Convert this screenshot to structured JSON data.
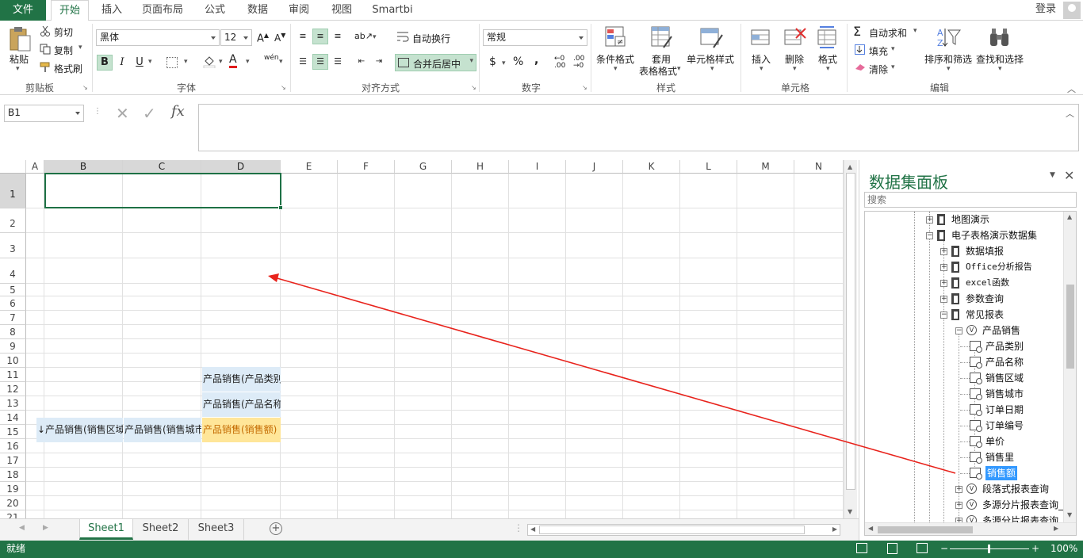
{
  "ribbon_tabs": {
    "file": "文件",
    "items": [
      "开始",
      "插入",
      "页面布局",
      "公式",
      "数据",
      "审阅",
      "视图",
      "Smartbi"
    ],
    "active": "开始",
    "login": "登录"
  },
  "clipboard": {
    "paste": "粘贴",
    "cut": "剪切",
    "copy": "复制",
    "format_painter": "格式刷",
    "group": "剪贴板"
  },
  "font": {
    "name": "黑体",
    "size": "12",
    "bold": "B",
    "italic": "I",
    "underline": "U",
    "font_color_letter": "A",
    "phonetic": "wén",
    "group": "字体"
  },
  "alignment": {
    "wrap": "自动换行",
    "merge": "合并后居中",
    "group": "对齐方式"
  },
  "number": {
    "format": "常规",
    "currency": "$",
    "percent": "%",
    "comma": ",",
    "group": "数字"
  },
  "styles": {
    "conditional": "条件格式",
    "table_l1": "套用",
    "table_l2": "表格格式",
    "cell_style": "单元格样式",
    "group": "样式"
  },
  "cells": {
    "insert": "插入",
    "delete": "删除",
    "format": "格式",
    "group": "单元格"
  },
  "editing": {
    "autosum": "自动求和",
    "fill": "填充",
    "clear": "清除",
    "sort": "排序和筛选",
    "find": "查找和选择",
    "group": "编辑"
  },
  "formula_bar": {
    "name_box": "B1",
    "fx": "fx",
    "value": ""
  },
  "columns": [
    "A",
    "B",
    "C",
    "D",
    "E",
    "F",
    "G",
    "H",
    "I",
    "J",
    "K",
    "L",
    "M",
    "N"
  ],
  "rows": [
    "1",
    "2",
    "3",
    "4",
    "5",
    "6",
    "7",
    "8",
    "9",
    "10",
    "11",
    "12",
    "13",
    "14",
    "15",
    "16",
    "17",
    "18",
    "19",
    "20",
    "21"
  ],
  "cells_data": {
    "D2": "产品销售(产品类别)",
    "D3": "产品销售(产品名称)",
    "B4": "↓产品销售(销售区域)",
    "C4": "产品销售(销售城市)",
    "D4": "产品销售(销售额)"
  },
  "sheet_tabs": [
    "Sheet1",
    "Sheet2",
    "Sheet3"
  ],
  "active_sheet": "Sheet1",
  "status": {
    "ready": "就绪",
    "zoom": "100%"
  },
  "panel": {
    "title": "数据集面板",
    "search_placeholder": "搜索",
    "tree": [
      {
        "label": "地图演示",
        "icon": "database-icon"
      },
      {
        "label": "电子表格演示数据集",
        "icon": "database-icon"
      },
      {
        "label": "数据填报",
        "icon": "database-icon"
      },
      {
        "label": "Office分析报告",
        "icon": "database-icon"
      },
      {
        "label": "excel函数",
        "icon": "database-icon"
      },
      {
        "label": "参数查询",
        "icon": "database-icon"
      },
      {
        "label": "常见报表",
        "icon": "database-icon"
      },
      {
        "label": "产品销售",
        "icon": "view-icon"
      },
      {
        "label": "产品类别",
        "icon": "field-icon"
      },
      {
        "label": "产品名称",
        "icon": "field-icon"
      },
      {
        "label": "销售区域",
        "icon": "field-icon"
      },
      {
        "label": "销售城市",
        "icon": "field-icon"
      },
      {
        "label": "订单日期",
        "icon": "field-icon"
      },
      {
        "label": "订单编号",
        "icon": "field-icon"
      },
      {
        "label": "单价",
        "icon": "field-icon"
      },
      {
        "label": "销售里",
        "icon": "field-icon"
      },
      {
        "label": "销售额",
        "icon": "field-icon"
      },
      {
        "label": "段落式报表查询",
        "icon": "view-icon"
      },
      {
        "label": "多源分片报表查询_按区域",
        "icon": "view-icon"
      },
      {
        "label": "多源分片报表查询_按时间",
        "icon": "view-icon"
      }
    ]
  },
  "colors": {
    "accent": "#217346",
    "arrow": "#e8231c",
    "field_bg": "#ddebf7",
    "measure_bg": "#ffe699",
    "selection": "#1e7145"
  }
}
